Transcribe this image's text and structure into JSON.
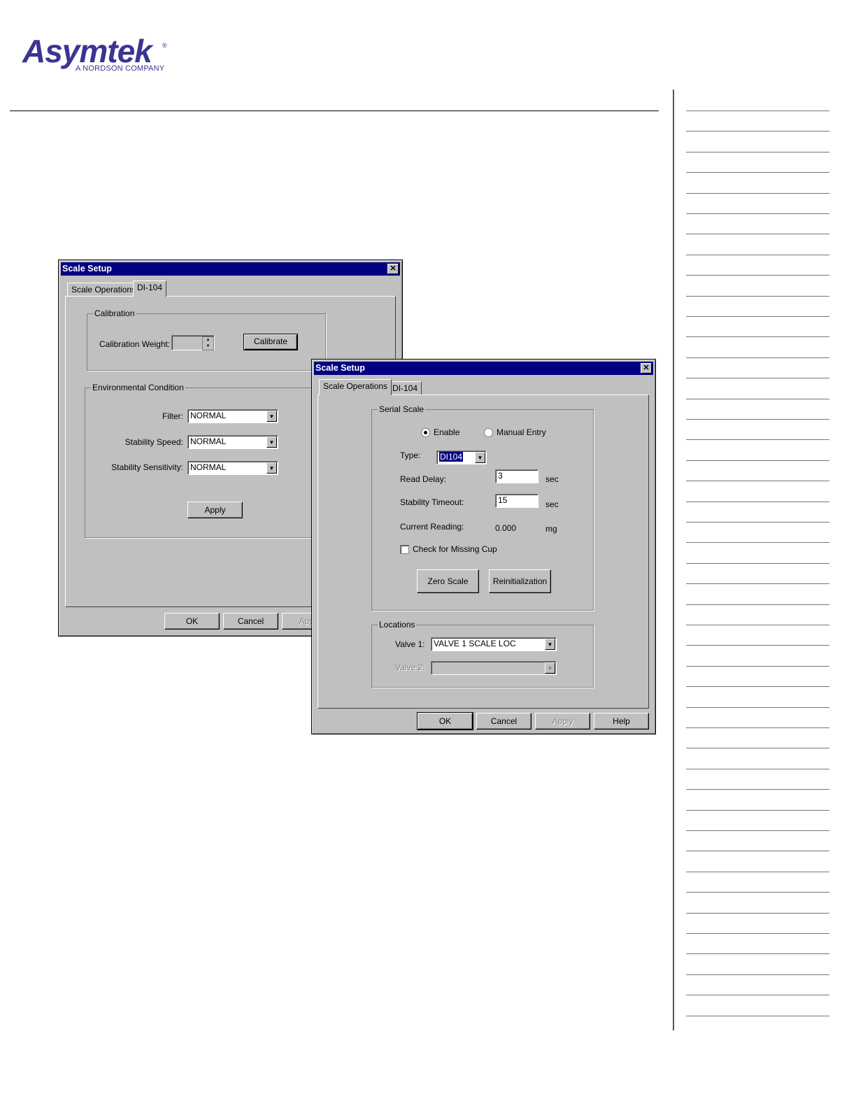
{
  "logo": {
    "wordmark": "Asymtek",
    "registered": "®",
    "subtitle": "A NORDSON COMPANY"
  },
  "dialog_back": {
    "title": "Scale Setup",
    "tabs": [
      "Scale Operations",
      "DI-104"
    ],
    "active_tab": "DI-104",
    "calibration": {
      "group_label": "Calibration",
      "weight_label": "Calibration Weight:",
      "weight_value": "",
      "calibrate_button": "Calibrate"
    },
    "environment": {
      "group_label": "Environmental Condition",
      "filter_label": "Filter:",
      "filter_value": "NORMAL",
      "speed_label": "Stability Speed:",
      "speed_value": "NORMAL",
      "sensitivity_label": "Stability Sensitivity:",
      "sensitivity_value": "NORMAL",
      "apply_button": "Apply"
    },
    "footer": {
      "ok": "OK",
      "cancel": "Cancel",
      "apply": "Apply"
    }
  },
  "dialog_front": {
    "title": "Scale Setup",
    "tabs": [
      "Scale Operations",
      "DI-104"
    ],
    "active_tab": "Scale Operations",
    "serial_scale": {
      "group_label": "Serial Scale",
      "enable_label": "Enable",
      "manual_label": "Manual Entry",
      "selected_mode": "Enable",
      "type_label": "Type:",
      "type_value": "DI104",
      "read_delay_label": "Read Delay:",
      "read_delay_value": "3",
      "read_delay_unit": "sec",
      "stability_timeout_label": "Stability Timeout:",
      "stability_timeout_value": "15",
      "stability_timeout_unit": "sec",
      "current_reading_label": "Current Reading:",
      "current_reading_value": "0.000",
      "current_reading_unit": "mg",
      "missing_cup_label": "Check for Missing Cup",
      "missing_cup_checked": false,
      "zero_button": "Zero Scale",
      "reinit_button": "Reinitialization"
    },
    "locations": {
      "group_label": "Locations",
      "valve1_label": "Valve 1:",
      "valve1_value": "VALVE 1 SCALE LOC",
      "valve2_label": "Valve 2:",
      "valve2_value": ""
    },
    "footer": {
      "ok": "OK",
      "cancel": "Cancel",
      "apply": "Apply",
      "help": "Help"
    }
  },
  "icons": {
    "close": "close-icon",
    "dropdown": "chevron-down-icon",
    "spinner": "spin-arrows-icon"
  }
}
